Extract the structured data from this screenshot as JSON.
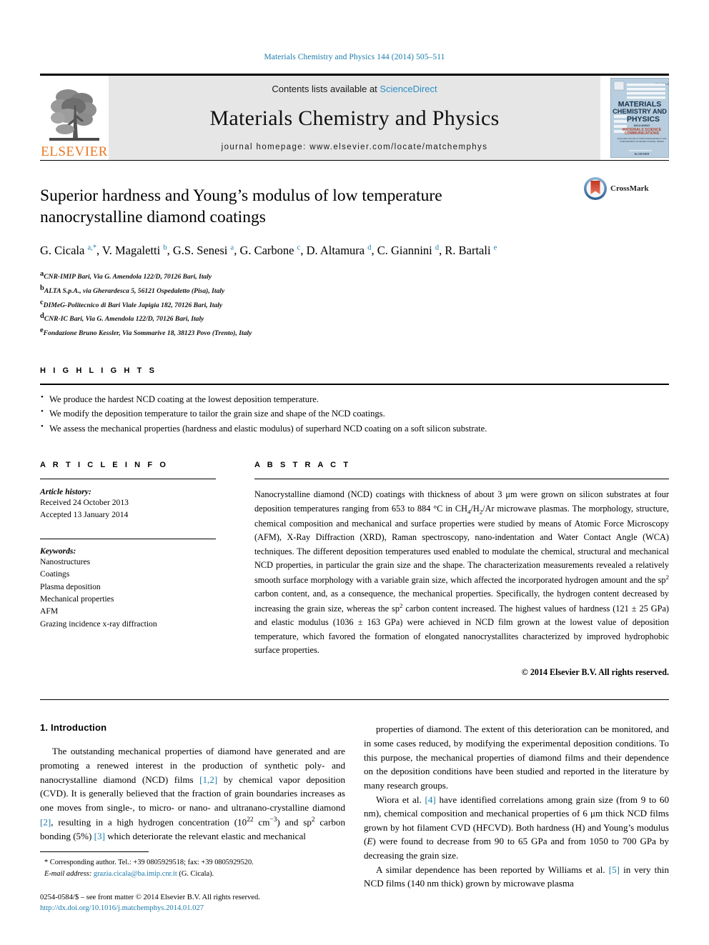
{
  "running_head": "Materials Chemistry and Physics 144 (2014) 505–511",
  "masthead": {
    "publisher": "ELSEVIER",
    "contents_prefix": "Contents lists available at ",
    "contents_link": "ScienceDirect",
    "journal_title": "Materials Chemistry and Physics",
    "homepage": "journal homepage: www.elsevier.com/locate/matchemphys",
    "cover_line1": "MATERIALS",
    "cover_line2": "CHEMISTRY AND",
    "cover_line3": "PHYSICS"
  },
  "crossmark": {
    "label": "CrossMark"
  },
  "article": {
    "title": "Superior hardness and Young’s modulus of low temperature nanocrystalline diamond coatings",
    "authors_html": "G. Cicala <sup>a,*</sup>, V. Magaletti <sup>b</sup>, G.S. Senesi <sup>a</sup>, G. Carbone <sup>c</sup>, D. Altamura <sup>d</sup>, C. Giannini <sup>d</sup>, R. Bartali <sup>e</sup>",
    "affiliations": [
      {
        "marker": "a",
        "text": "CNR-IMIP Bari, Via G. Amendola 122/D, 70126 Bari, Italy"
      },
      {
        "marker": "b",
        "text": "ALTA S.p.A., via Gherardesca 5, 56121 Ospedaletto (Pisa), Italy"
      },
      {
        "marker": "c",
        "text": "DIMeG-Politecnico di Bari Viale Japigia 182, 70126 Bari, Italy"
      },
      {
        "marker": "d",
        "text": "CNR-IC Bari, Via G. Amendola 122/D, 70126 Bari, Italy"
      },
      {
        "marker": "e",
        "text": "Fondazione Bruno Kessler, Via Sommarive 18, 38123 Povo (Trento), Italy"
      }
    ]
  },
  "highlights": {
    "heading": "H I G H L I G H T S",
    "items": [
      "We produce the hardest NCD coating at the lowest deposition temperature.",
      "We modify the deposition temperature to tailor the grain size and shape of the NCD coatings.",
      "We assess the mechanical properties (hardness and elastic modulus) of superhard NCD coating on a soft silicon substrate."
    ]
  },
  "article_info": {
    "heading": "A R T I C L E   I N F O",
    "history_label": "Article history:",
    "history": [
      "Received 24 October 2013",
      "Accepted 13 January 2014"
    ],
    "keywords_label": "Keywords:",
    "keywords": [
      "Nanostructures",
      "Coatings",
      "Plasma deposition",
      "Mechanical properties",
      "AFM",
      "Grazing incidence x-ray diffraction"
    ]
  },
  "abstract": {
    "heading": "A B S T R A C T",
    "body_html": "Nanocrystalline diamond (NCD) coatings with thickness of about 3 μm were grown on silicon substrates at four deposition temperatures ranging from 653 to 884 °C in CH<sub class=\"num\">4</sub>/H<sub class=\"num\">2</sub>/Ar microwave plasmas. The morphology, structure, chemical composition and mechanical and surface properties were studied by means of Atomic Force Microscopy (AFM), X-Ray Diffraction (XRD), Raman spectroscopy, nano-indentation and Water Contact Angle (WCA) techniques. The different deposition temperatures used enabled to modulate the chemical, structural and mechanical NCD properties, in particular the grain size and the shape. The characterization measurements revealed a relatively smooth surface morphology with a variable grain size, which affected the incorporated hydrogen amount and the sp<sup class=\"num\">2</sup> carbon content, and, as a consequence, the mechanical properties. Specifically, the hydrogen content decreased by increasing the grain size, whereas the sp<sup class=\"num\">2</sup> carbon content increased. The highest values of hardness (121 ± 25 GPa) and elastic modulus (1036 ± 163 GPa) were achieved in NCD film grown at the lowest value of deposition temperature, which favored the formation of elongated nanocrystallites characterized by improved hydrophobic surface properties.",
    "copyright": "© 2014 Elsevier B.V. All rights reserved."
  },
  "introduction": {
    "heading": "1.  Introduction",
    "left_paragraph_html": "The outstanding mechanical properties of diamond have generated and are promoting a renewed interest in the production of synthetic poly- and nanocrystalline diamond (NCD) films <span class=\"ref\">[1,2]</span> by chemical vapor deposition (CVD). It is generally believed that the fraction of grain boundaries increases as one moves from single-, to micro- or nano- and ultranano-crystalline diamond <span class=\"ref\">[2]</span>, resulting in a high hydrogen concentration (10<sup class=\"num\">22</sup> cm<sup class=\"num\">−3</sup>) and sp<sup class=\"num\">2</sup> carbon bonding (5%) <span class=\"ref\">[3]</span> which deteriorate the relevant elastic and mechanical",
    "right_paragraphs_html": [
      "properties of diamond. The extent of this deterioration can be monitored, and in some cases reduced, by modifying the experimental deposition conditions. To this purpose, the mechanical properties of diamond films and their dependence on the deposition conditions have been studied and reported in the literature by many research groups.",
      "Wiora et al. <span class=\"ref\">[4]</span> have identified correlations among grain size (from 9 to 60 nm), chemical composition and mechanical properties of 6 μm thick NCD films grown by hot filament CVD (HFCVD). Both hardness (H) and Young’s modulus (<i>E</i>) were found to decrease from 90 to 65 GPa and from 1050 to 700 GPa by decreasing the grain size.",
      "A similar dependence has been reported by Williams et al. <span class=\"ref\">[5]</span> in very thin NCD films (140 nm thick) grown by microwave plasma"
    ]
  },
  "footnotes": {
    "corresponding_html": "* Corresponding author. Tel.: +39 0805929518; fax: +39 0805929520.",
    "email_label": "E-mail address:",
    "email": "grazia.cicala@ba.imip.cnr.it",
    "email_suffix": "(G. Cicala).",
    "imprint": "0254-0584/$ – see front matter © 2014 Elsevier B.V. All rights reserved.",
    "doi": "http://dx.doi.org/10.1016/j.matchemphys.2014.01.027"
  },
  "colors": {
    "link": "#1a7bab",
    "sciencedirect": "#2b8fc4",
    "elsevier_orange": "#E87722",
    "masthead_bg": "#e6e6e6"
  }
}
